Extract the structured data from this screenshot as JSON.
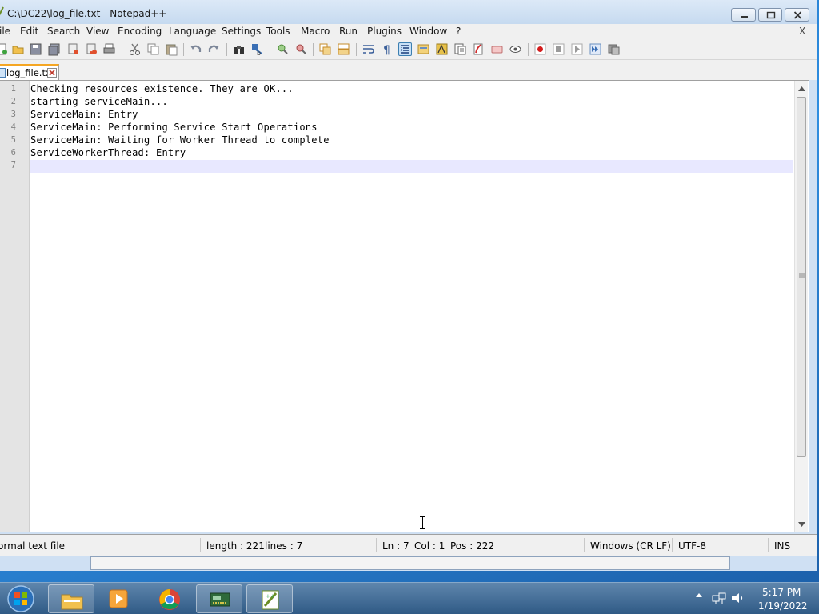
{
  "window": {
    "title": "C:\\DC22\\log_file.txt - Notepad++"
  },
  "menu": {
    "items": [
      "ile",
      "Edit",
      "Search",
      "View",
      "Encoding",
      "Language",
      "Settings",
      "Tools",
      "Macro",
      "Run",
      "Plugins",
      "Window",
      "?"
    ],
    "close_label": "X"
  },
  "toolbar": {
    "icons": [
      "new-icon",
      "open-icon",
      "save-icon",
      "save-all-icon",
      "close-icon",
      "close-all-icon",
      "print-icon",
      "cut-icon",
      "copy-icon",
      "paste-icon",
      "undo-icon",
      "redo-icon",
      "find-icon",
      "replace-icon",
      "zoom-in-icon",
      "zoom-out-icon",
      "sync-vertical-icon",
      "sync-horizontal-icon",
      "word-wrap-icon",
      "show-all-chars-icon",
      "indent-guide-icon",
      "user-language-icon",
      "doc-map-icon",
      "function-list-icon",
      "folder-workspace-icon",
      "monitoring-icon",
      "eye-icon",
      "record-macro-icon",
      "stop-record-icon",
      "playback-icon",
      "run-multiple-icon",
      "save-macro-icon"
    ]
  },
  "tab": {
    "label": "log_file.txt"
  },
  "editor": {
    "lines": [
      {
        "num": "1",
        "text": "Checking resources existence. They are OK..."
      },
      {
        "num": "2",
        "text": "starting serviceMain..."
      },
      {
        "num": "3",
        "text": "ServiceMain: Entry"
      },
      {
        "num": "4",
        "text": "ServiceMain: Performing Service Start Operations"
      },
      {
        "num": "5",
        "text": "ServiceMain: Waiting for Worker Thread to complete"
      },
      {
        "num": "6",
        "text": "ServiceWorkerThread: Entry"
      },
      {
        "num": "7",
        "text": ""
      }
    ]
  },
  "status": {
    "file_type": "ormal text file",
    "length": "length : 221",
    "lines": "lines : 7",
    "ln": "Ln : 7",
    "col": "Col : 1",
    "pos": "Pos : 222",
    "eol": "Windows (CR LF)",
    "encoding": "UTF-8",
    "mode": "INS"
  },
  "taskbar": {
    "time": "5:17 PM",
    "date": "1/19/2022"
  }
}
